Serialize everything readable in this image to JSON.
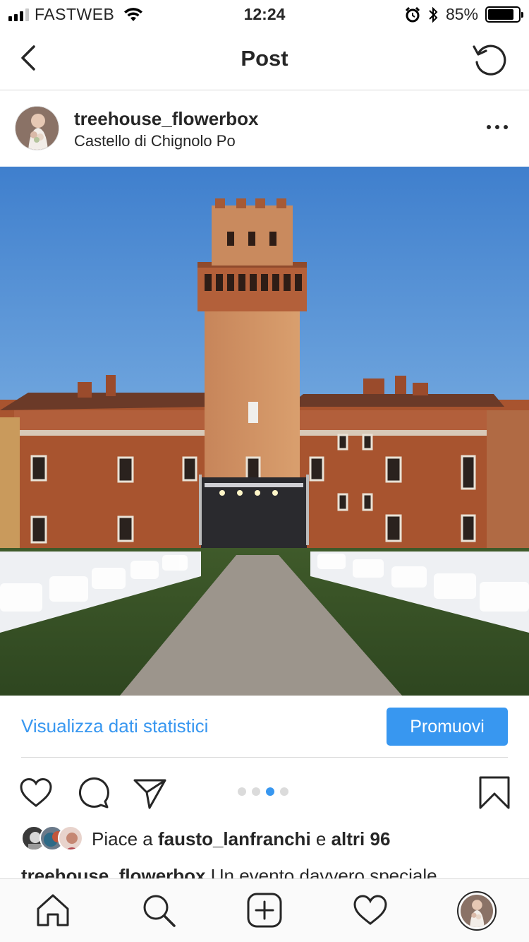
{
  "status_bar": {
    "carrier": "FASTWEB",
    "time": "12:24",
    "battery_percent": "85%",
    "battery_level": 0.85,
    "icons": [
      "signal-icon",
      "wifi-icon",
      "alarm-icon",
      "bluetooth-icon",
      "battery-icon"
    ]
  },
  "nav": {
    "title": "Post",
    "back_icon": "chevron-left-icon",
    "refresh_icon": "refresh-icon"
  },
  "post": {
    "username": "treehouse_flowerbox",
    "location": "Castello di Chignolo Po",
    "more_icon": "more-horizontal-icon",
    "image_subject": "castle-courtyard-event-photo"
  },
  "insights": {
    "link_label": "Visualizza dati statistici",
    "promote_label": "Promuovi"
  },
  "actions": {
    "icons": [
      "heart-icon",
      "comment-icon",
      "share-icon",
      "bookmark-icon"
    ],
    "carousel_dots": 4,
    "carousel_active_index": 2
  },
  "likes": {
    "prefix": "Piace a ",
    "user": "fausto_lanfranchi",
    "middle": " e ",
    "others": "altri 96"
  },
  "caption": {
    "username": "treehouse_flowerbox",
    "text": " Un evento davvero speciale"
  },
  "tabbar": {
    "items": [
      "home-icon",
      "search-icon",
      "new-post-icon",
      "activity-icon",
      "profile-icon"
    ]
  },
  "colors": {
    "accent": "#3897f0",
    "text": "#262626",
    "divider": "#dbdbdb"
  }
}
